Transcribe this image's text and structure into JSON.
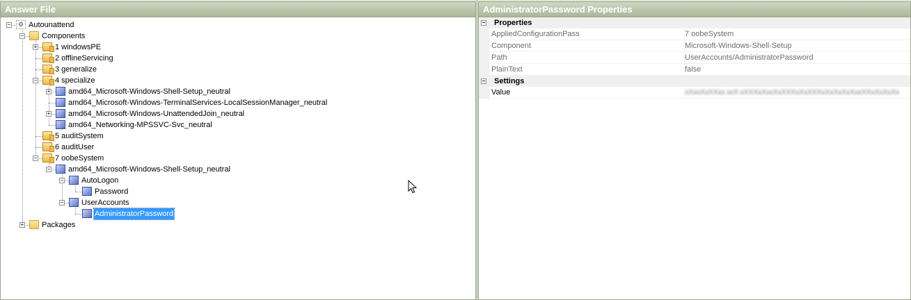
{
  "left_panel": {
    "title": "Answer File",
    "tree": [
      {
        "id": "autounattend",
        "label": "Autounattend",
        "icon": "gear-icon",
        "level": 0,
        "expander": "-"
      },
      {
        "id": "components",
        "label": "Components",
        "icon": "folder-icon",
        "level": 1,
        "expander": "-"
      },
      {
        "id": "windowspe",
        "label": "1 windowsPE",
        "icon": "pass-icon",
        "level": 2,
        "expander": "+"
      },
      {
        "id": "offlineservicing",
        "label": "2 offlineServicing",
        "icon": "pass-icon",
        "level": 2,
        "expander": ""
      },
      {
        "id": "generalize",
        "label": "3 generalize",
        "icon": "pass-icon",
        "level": 2,
        "expander": ""
      },
      {
        "id": "specialize",
        "label": "4 specialize",
        "icon": "pass-icon",
        "level": 2,
        "expander": "-"
      },
      {
        "id": "spec-shell",
        "label": "amd64_Microsoft-Windows-Shell-Setup_neutral",
        "icon": "component-icon",
        "level": 3,
        "expander": "+"
      },
      {
        "id": "spec-ts",
        "label": "amd64_Microsoft-Windows-TerminalServices-LocalSessionManager_neutral",
        "icon": "component-icon",
        "level": 3,
        "expander": ""
      },
      {
        "id": "spec-join",
        "label": "amd64_Microsoft-Windows-UnattendedJoin_neutral",
        "icon": "component-icon",
        "level": 3,
        "expander": "+"
      },
      {
        "id": "spec-net",
        "label": "amd64_Networking-MPSSVC-Svc_neutral",
        "icon": "component-icon",
        "level": 3,
        "expander": ""
      },
      {
        "id": "auditsystem",
        "label": "5 auditSystem",
        "icon": "pass-icon",
        "level": 2,
        "expander": ""
      },
      {
        "id": "audituser",
        "label": "6 auditUser",
        "icon": "pass-icon",
        "level": 2,
        "expander": ""
      },
      {
        "id": "oobesystem",
        "label": "7 oobeSystem",
        "icon": "pass-icon",
        "level": 2,
        "expander": "-"
      },
      {
        "id": "oobe-shell",
        "label": "amd64_Microsoft-Windows-Shell-Setup_neutral",
        "icon": "component-icon",
        "level": 3,
        "expander": "-"
      },
      {
        "id": "autologon",
        "label": "AutoLogon",
        "icon": "component-icon",
        "level": 4,
        "expander": "-"
      },
      {
        "id": "password",
        "label": "Password",
        "icon": "component-icon",
        "level": 5,
        "expander": ""
      },
      {
        "id": "useraccounts",
        "label": "UserAccounts",
        "icon": "component-icon",
        "level": 4,
        "expander": "-"
      },
      {
        "id": "adminpassword",
        "label": "AdministratorPassword",
        "icon": "component-icon",
        "level": 5,
        "expander": "",
        "selected": true
      },
      {
        "id": "packages",
        "label": "Packages",
        "icon": "folder-icon",
        "level": 1,
        "expander": "+"
      }
    ]
  },
  "right_panel": {
    "title": "AdministratorPassword Properties",
    "categories": [
      {
        "name": "Properties",
        "expander": "-",
        "rows": [
          {
            "name": "AppliedConfigurationPass",
            "value": "7 oobeSystem"
          },
          {
            "name": "Component",
            "value": "Microsoft-Windows-Shell-Setup"
          },
          {
            "name": "Path",
            "value": "UserAccounts/AdministratorPassword"
          },
          {
            "name": "PlainText",
            "value": "false"
          }
        ]
      },
      {
        "name": "Settings",
        "expander": "-",
        "rows": [
          {
            "name": "Value",
            "value": "xXxxXxXXxx xxX xXXXxXxxXxXXXxXxXXXxXxXxXxXxxXXxXxXxXx",
            "blurred": true
          }
        ]
      }
    ]
  },
  "colors": {
    "selection": "#3399ff",
    "header_green": "#a9b79a"
  }
}
